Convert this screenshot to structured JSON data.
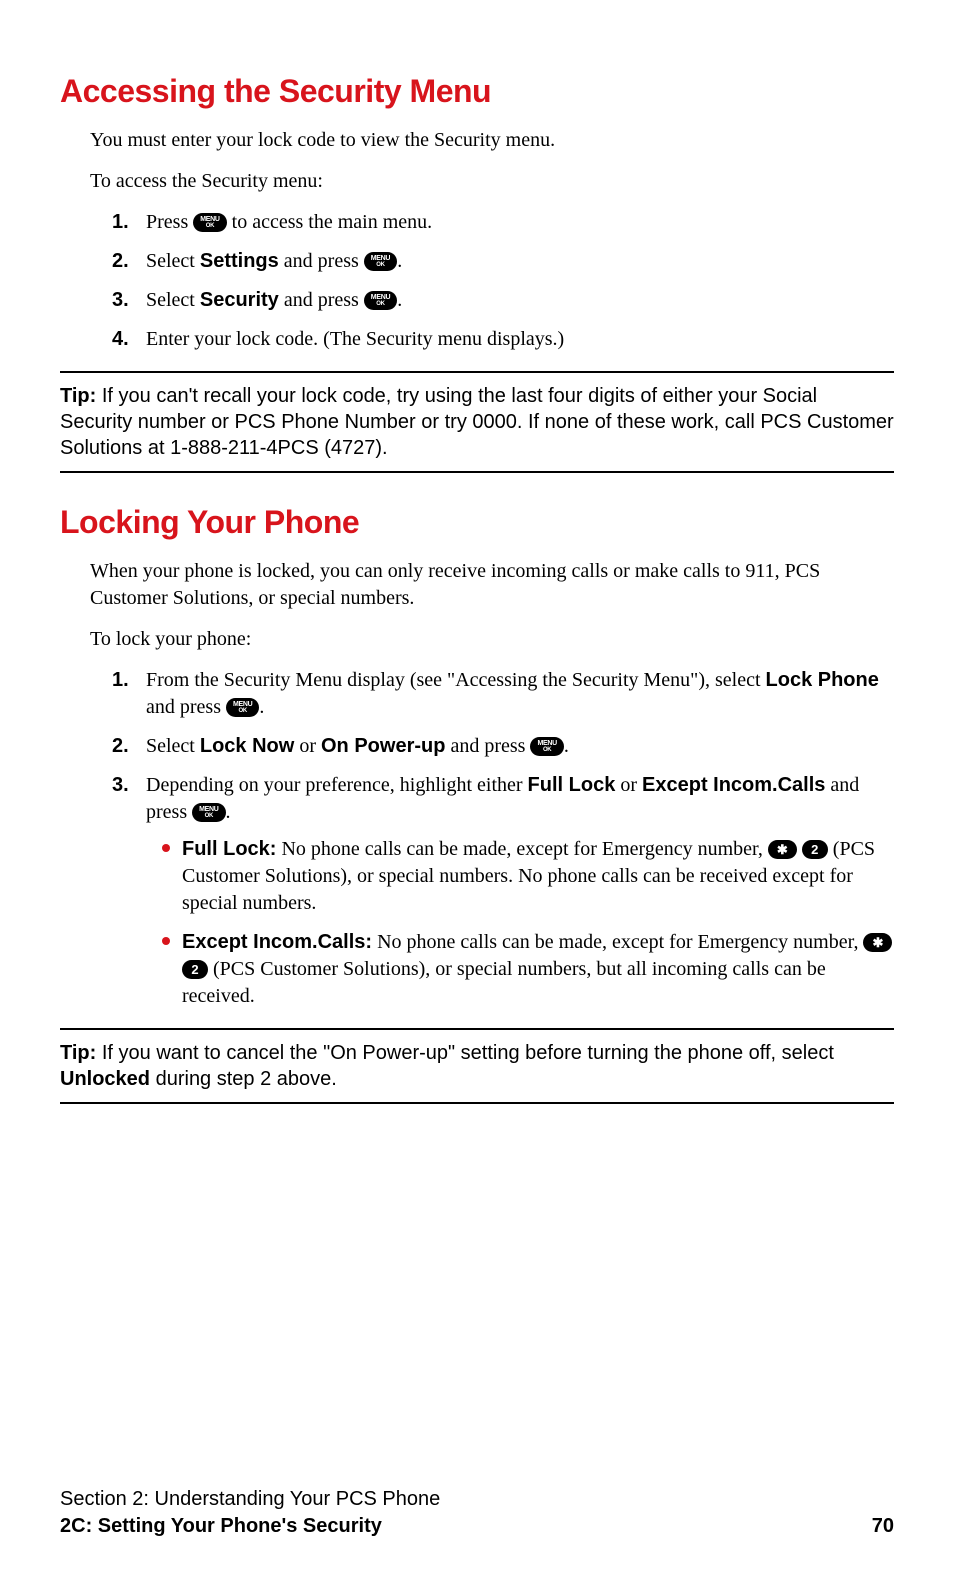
{
  "section1": {
    "heading": "Accessing the Security Menu",
    "intro1": "You must enter your lock code to view the Security menu.",
    "intro2": "To access the Security menu:",
    "steps": {
      "s1a": "Press ",
      "s1b": " to access the main menu.",
      "s2a": "Select ",
      "s2b": "Settings",
      "s2c": " and press ",
      "s3a": "Select ",
      "s3b": "Security",
      "s3c": " and press ",
      "s4": "Enter your lock code. (The Security menu displays.)"
    },
    "nums": {
      "n1": "1.",
      "n2": "2.",
      "n3": "3.",
      "n4": "4."
    }
  },
  "tip1": {
    "label": "Tip:",
    "body": " If you can't recall your lock code, try using the last four digits of either your Social Security number or PCS Phone Number or try 0000. If none of these work, call PCS Customer Solutions at 1-888-211-4PCS (4727)."
  },
  "section2": {
    "heading": "Locking Your Phone",
    "intro1": "When your phone is locked, you can only receive incoming calls or make calls to 911, PCS Customer Solutions, or special numbers.",
    "intro2": "To lock your phone:",
    "steps": {
      "s1a": "From the Security Menu display (see \"Accessing the Security Menu\"), select ",
      "s1b": "Lock Phone",
      "s1c": " and press ",
      "s2a": "Select ",
      "s2b": "Lock Now",
      "s2c": " or ",
      "s2d": "On Power-up",
      "s2e": " and press ",
      "s3a": "Depending on your preference, highlight either ",
      "s3b": "Full Lock",
      "s3c": " or ",
      "s3d": "Except Incom.Calls",
      "s3e": " and press "
    },
    "nums": {
      "n1": "1.",
      "n2": "2.",
      "n3": "3."
    },
    "bullets": {
      "b1label": "Full Lock:",
      "b1a": " No phone calls can be made, except for Emergency number, ",
      "b1b": " (PCS Customer Solutions), or special numbers. No phone calls can be received except for special numbers.",
      "b2label": "Except Incom.Calls:",
      "b2a": " No phone calls can be made, except for Emergency number, ",
      "b2b": " (PCS Customer Solutions), or special numbers, but all incoming calls can be received."
    }
  },
  "tip2": {
    "label": "Tip:",
    "a": " If you want to cancel the \"On Power-up\" setting before turning the phone off, select ",
    "b": "Unlocked",
    "c": " during step 2 above."
  },
  "keys": {
    "menu_top": "MENU",
    "menu_bot": "OK",
    "star": "✱",
    "two": "2"
  },
  "footer": {
    "line1": "Section 2: Understanding Your PCS Phone",
    "line2": "2C: Setting Your Phone's Security",
    "page": "70"
  },
  "period": "."
}
